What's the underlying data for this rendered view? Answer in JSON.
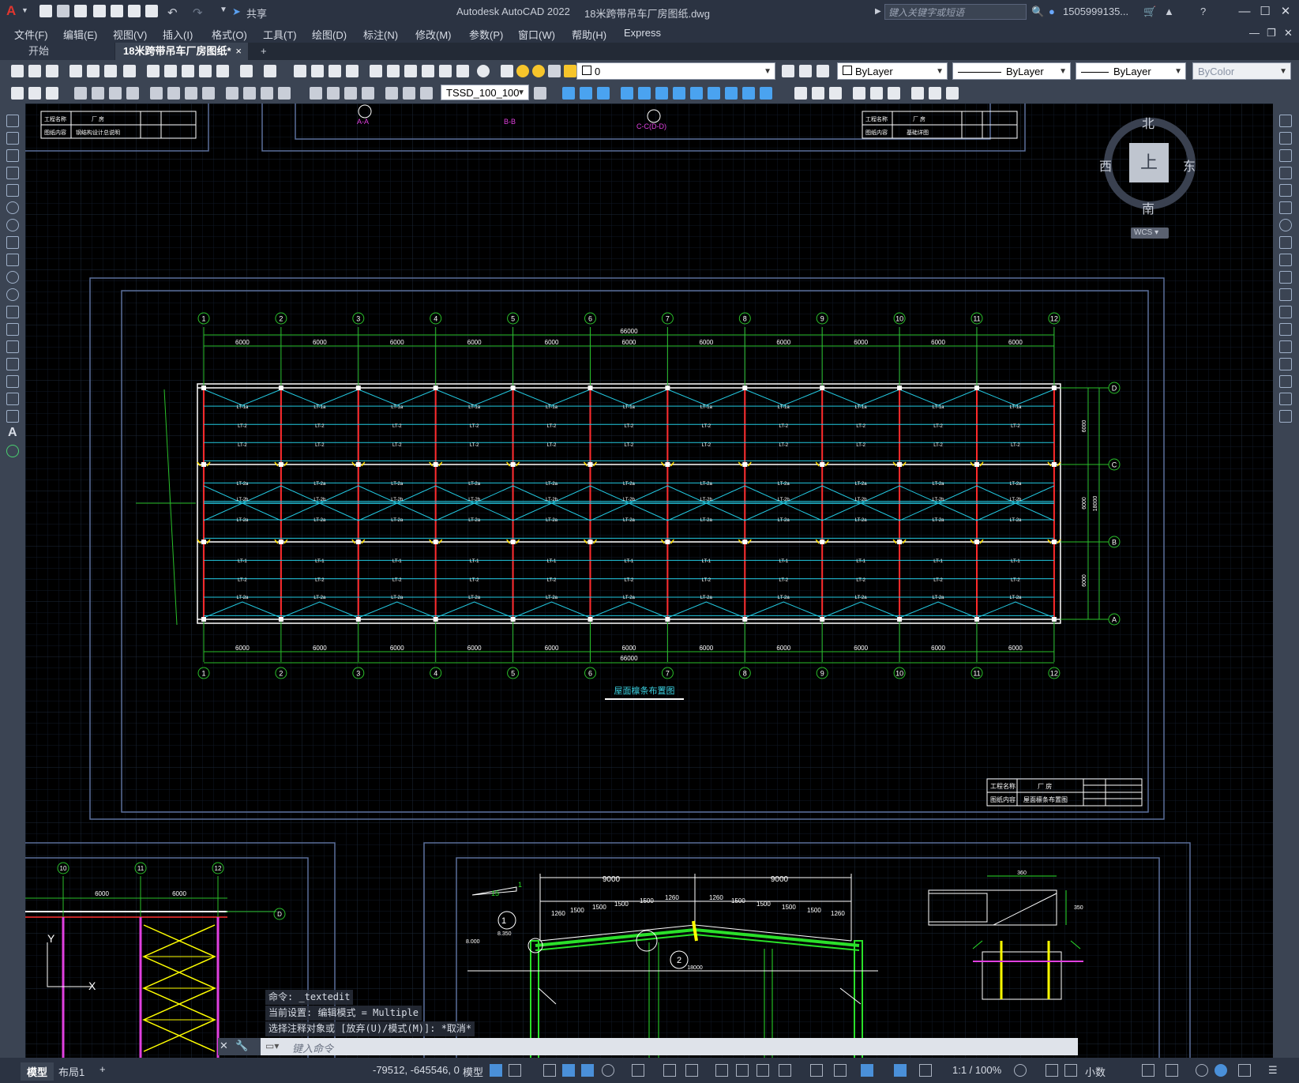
{
  "app": {
    "title": "Autodesk AutoCAD 2022",
    "filename": "18米跨带吊车厂房图纸.dwg",
    "share": "共享",
    "search_placeholder": "键入关键字或短语",
    "user": "1505999135...",
    "logo": "A"
  },
  "menu": [
    "文件(F)",
    "编辑(E)",
    "视图(V)",
    "插入(I)",
    "格式(O)",
    "工具(T)",
    "绘图(D)",
    "标注(N)",
    "修改(M)",
    "参数(P)",
    "窗口(W)",
    "帮助(H)",
    "Express"
  ],
  "tabs": {
    "start": "开始",
    "active": "18米跨带吊车厂房图纸*",
    "close": "×",
    "add": "+"
  },
  "toolbar": {
    "layer": "0",
    "color": "ByLayer",
    "linetype": "ByLayer",
    "lineweight": "ByLayer",
    "plotstyle": "ByColor",
    "dimstyle": "TSSD_100_100"
  },
  "viewcube": {
    "north": "北",
    "south": "南",
    "east": "东",
    "west": "西",
    "top": "上",
    "wcs": "WCS"
  },
  "drawing": {
    "axes_top": [
      "1",
      "2",
      "3",
      "4",
      "5",
      "6",
      "7",
      "8",
      "9",
      "10",
      "11",
      "12"
    ],
    "bay_dim": "6000",
    "total_dim": "66000",
    "rows": [
      "D",
      "C",
      "B",
      "A"
    ],
    "row_dim": "6000",
    "span_dim": "18000",
    "title": "屋面檩条布置图",
    "tb_main": {
      "project_label": "工程名称",
      "project": "厂 房",
      "content_label": "图纸内容",
      "content": "屋面檩条布置图"
    },
    "tb_tl": {
      "project_label": "工程名称",
      "project": "厂 房",
      "content_label": "图纸内容",
      "content": "钢结构设计总说明"
    },
    "tb_tr": {
      "project_label": "工程名称",
      "project": "厂 房",
      "content_label": "图纸内容",
      "content": "基础详图"
    },
    "sections": [
      "A-A",
      "B-B",
      "C-C(D-D)"
    ],
    "purlin_labels": [
      "LT-1a",
      "LT-1",
      "LT-2",
      "LT-2a",
      "LT-2b"
    ],
    "bottom_left": {
      "axes": [
        "10",
        "11",
        "12"
      ],
      "dim": "6000",
      "row": "D"
    },
    "bottom_mid": {
      "span": "9000",
      "dims": [
        "1260",
        "1500",
        "1500",
        "1500",
        "1500",
        "1260"
      ],
      "slope": "1",
      "slope_run": "15",
      "elev": "8.000",
      "elev2": "8.350",
      "callouts": [
        "1",
        "2"
      ],
      "width": "18000"
    },
    "bottom_right": {
      "dim": "360",
      "dim2": "350"
    }
  },
  "command": {
    "history": [
      "命令: _textedit",
      "当前设置: 编辑模式 = Multiple",
      "选择注释对象或 [放弃(U)/模式(M)]: *取消*"
    ],
    "placeholder": "键入命令"
  },
  "status": {
    "model_tab": "模型",
    "layout_tab": "布局1",
    "add": "+",
    "coords": "-79512, -645546, 0",
    "mode": "模型",
    "scale": "1:1 / 100%",
    "units": "小数"
  }
}
